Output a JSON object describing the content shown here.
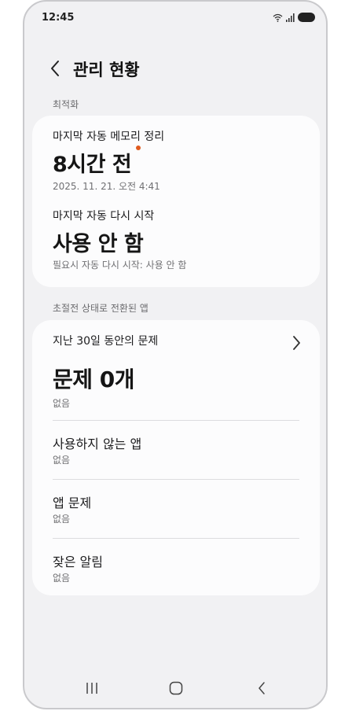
{
  "status_bar": {
    "time": "12:45"
  },
  "header": {
    "title": "관리 현황"
  },
  "optimization": {
    "section_label": "최적화",
    "last_auto_memory_cleanup": {
      "label": "마지막 자동 메모리 정리",
      "value": "8시간 전",
      "timestamp": "2025. 11. 21. 오전 4:41"
    },
    "last_auto_restart": {
      "label": "마지막 자동 다시 시작",
      "value": "사용 안 함",
      "detail": "필요시 자동 다시 시작: 사용 안 함"
    }
  },
  "deep_sleep_apps": {
    "section_label": "초절전 상태로 전환된 앱",
    "problems_row": {
      "label": "지난 30일 동안의 문제",
      "value": "문제 0개",
      "detail": "없음"
    },
    "rows": [
      {
        "title": "사용하지 않는 앱",
        "sub": "없음"
      },
      {
        "title": "앱 문제",
        "sub": "없음"
      },
      {
        "title": "잦은 알림",
        "sub": "없음"
      }
    ]
  },
  "colors": {
    "background": "#f1f1f3",
    "card": "#fcfcfd",
    "notification_dot": "#e05a1e"
  }
}
